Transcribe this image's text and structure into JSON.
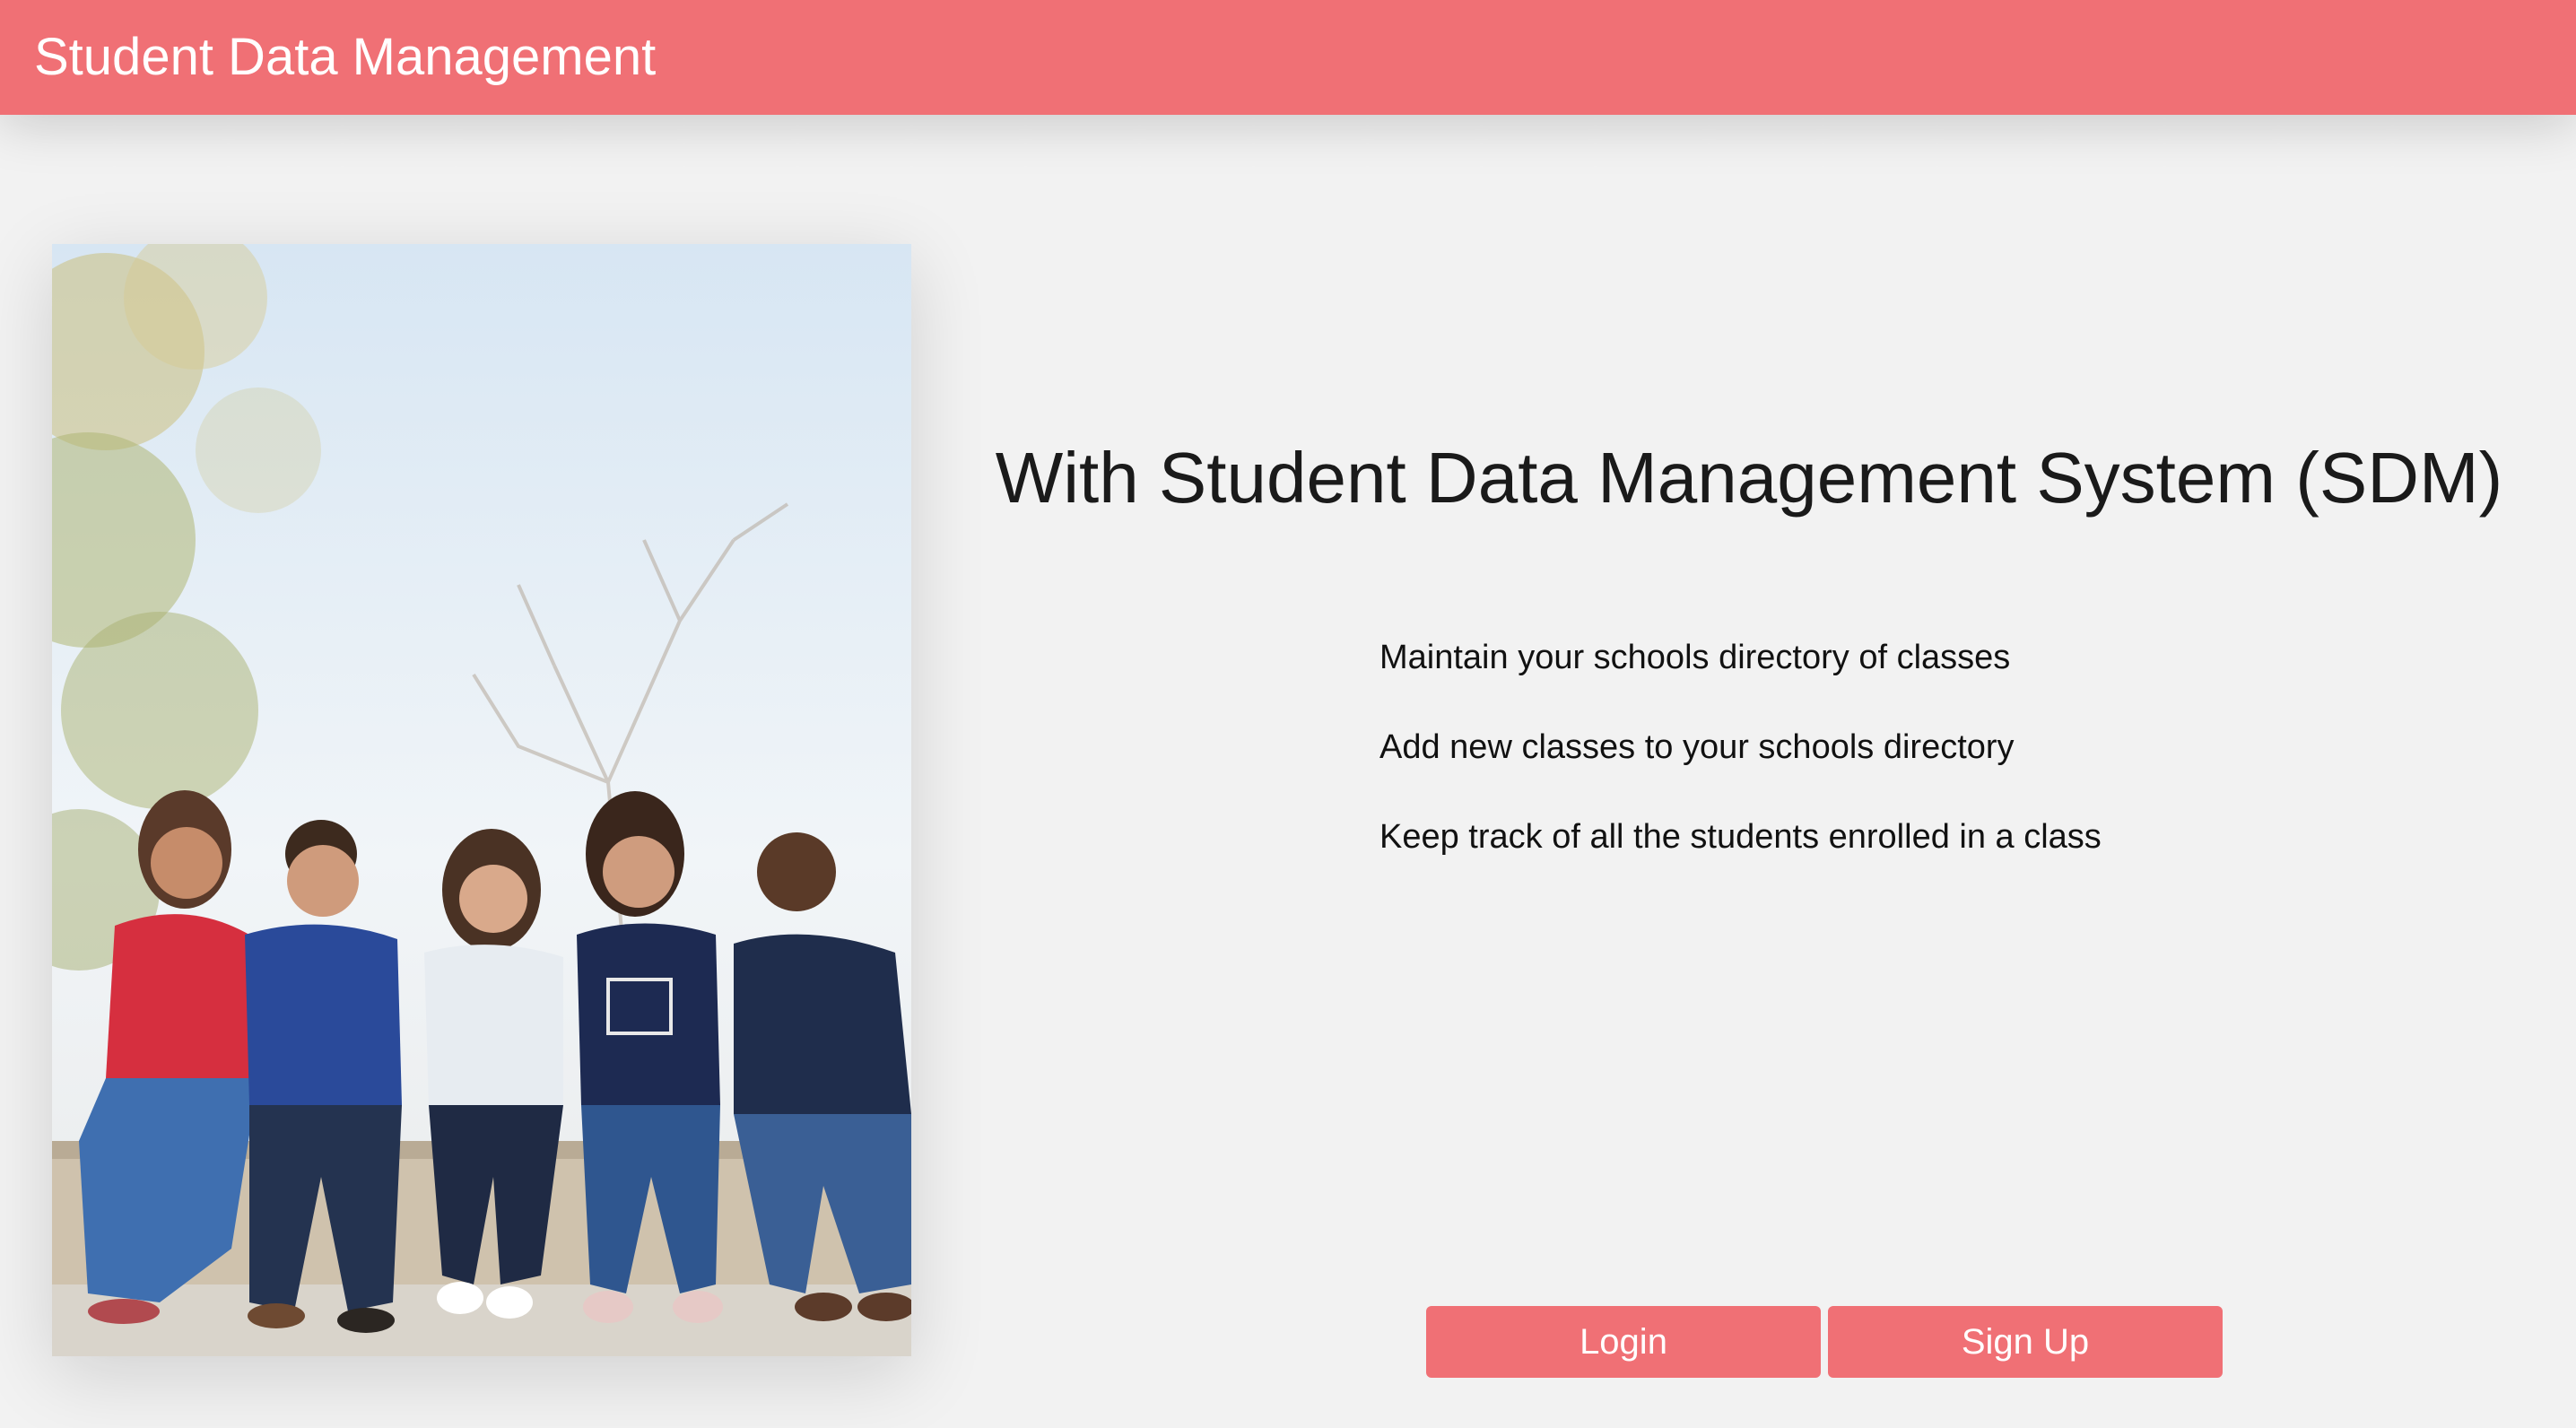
{
  "header": {
    "title": "Student Data Management",
    "background_color": "#f07075"
  },
  "hero": {
    "image_description": "photo-five-smiling-students"
  },
  "main": {
    "headline": "With Student Data Management System (SDM)",
    "features": [
      "Maintain your schools directory of classes",
      "Add new classes to your schools directory",
      "Keep track of all the students enrolled in a class"
    ]
  },
  "actions": {
    "login_label": "Login",
    "signup_label": "Sign Up",
    "button_color": "#f07075"
  }
}
